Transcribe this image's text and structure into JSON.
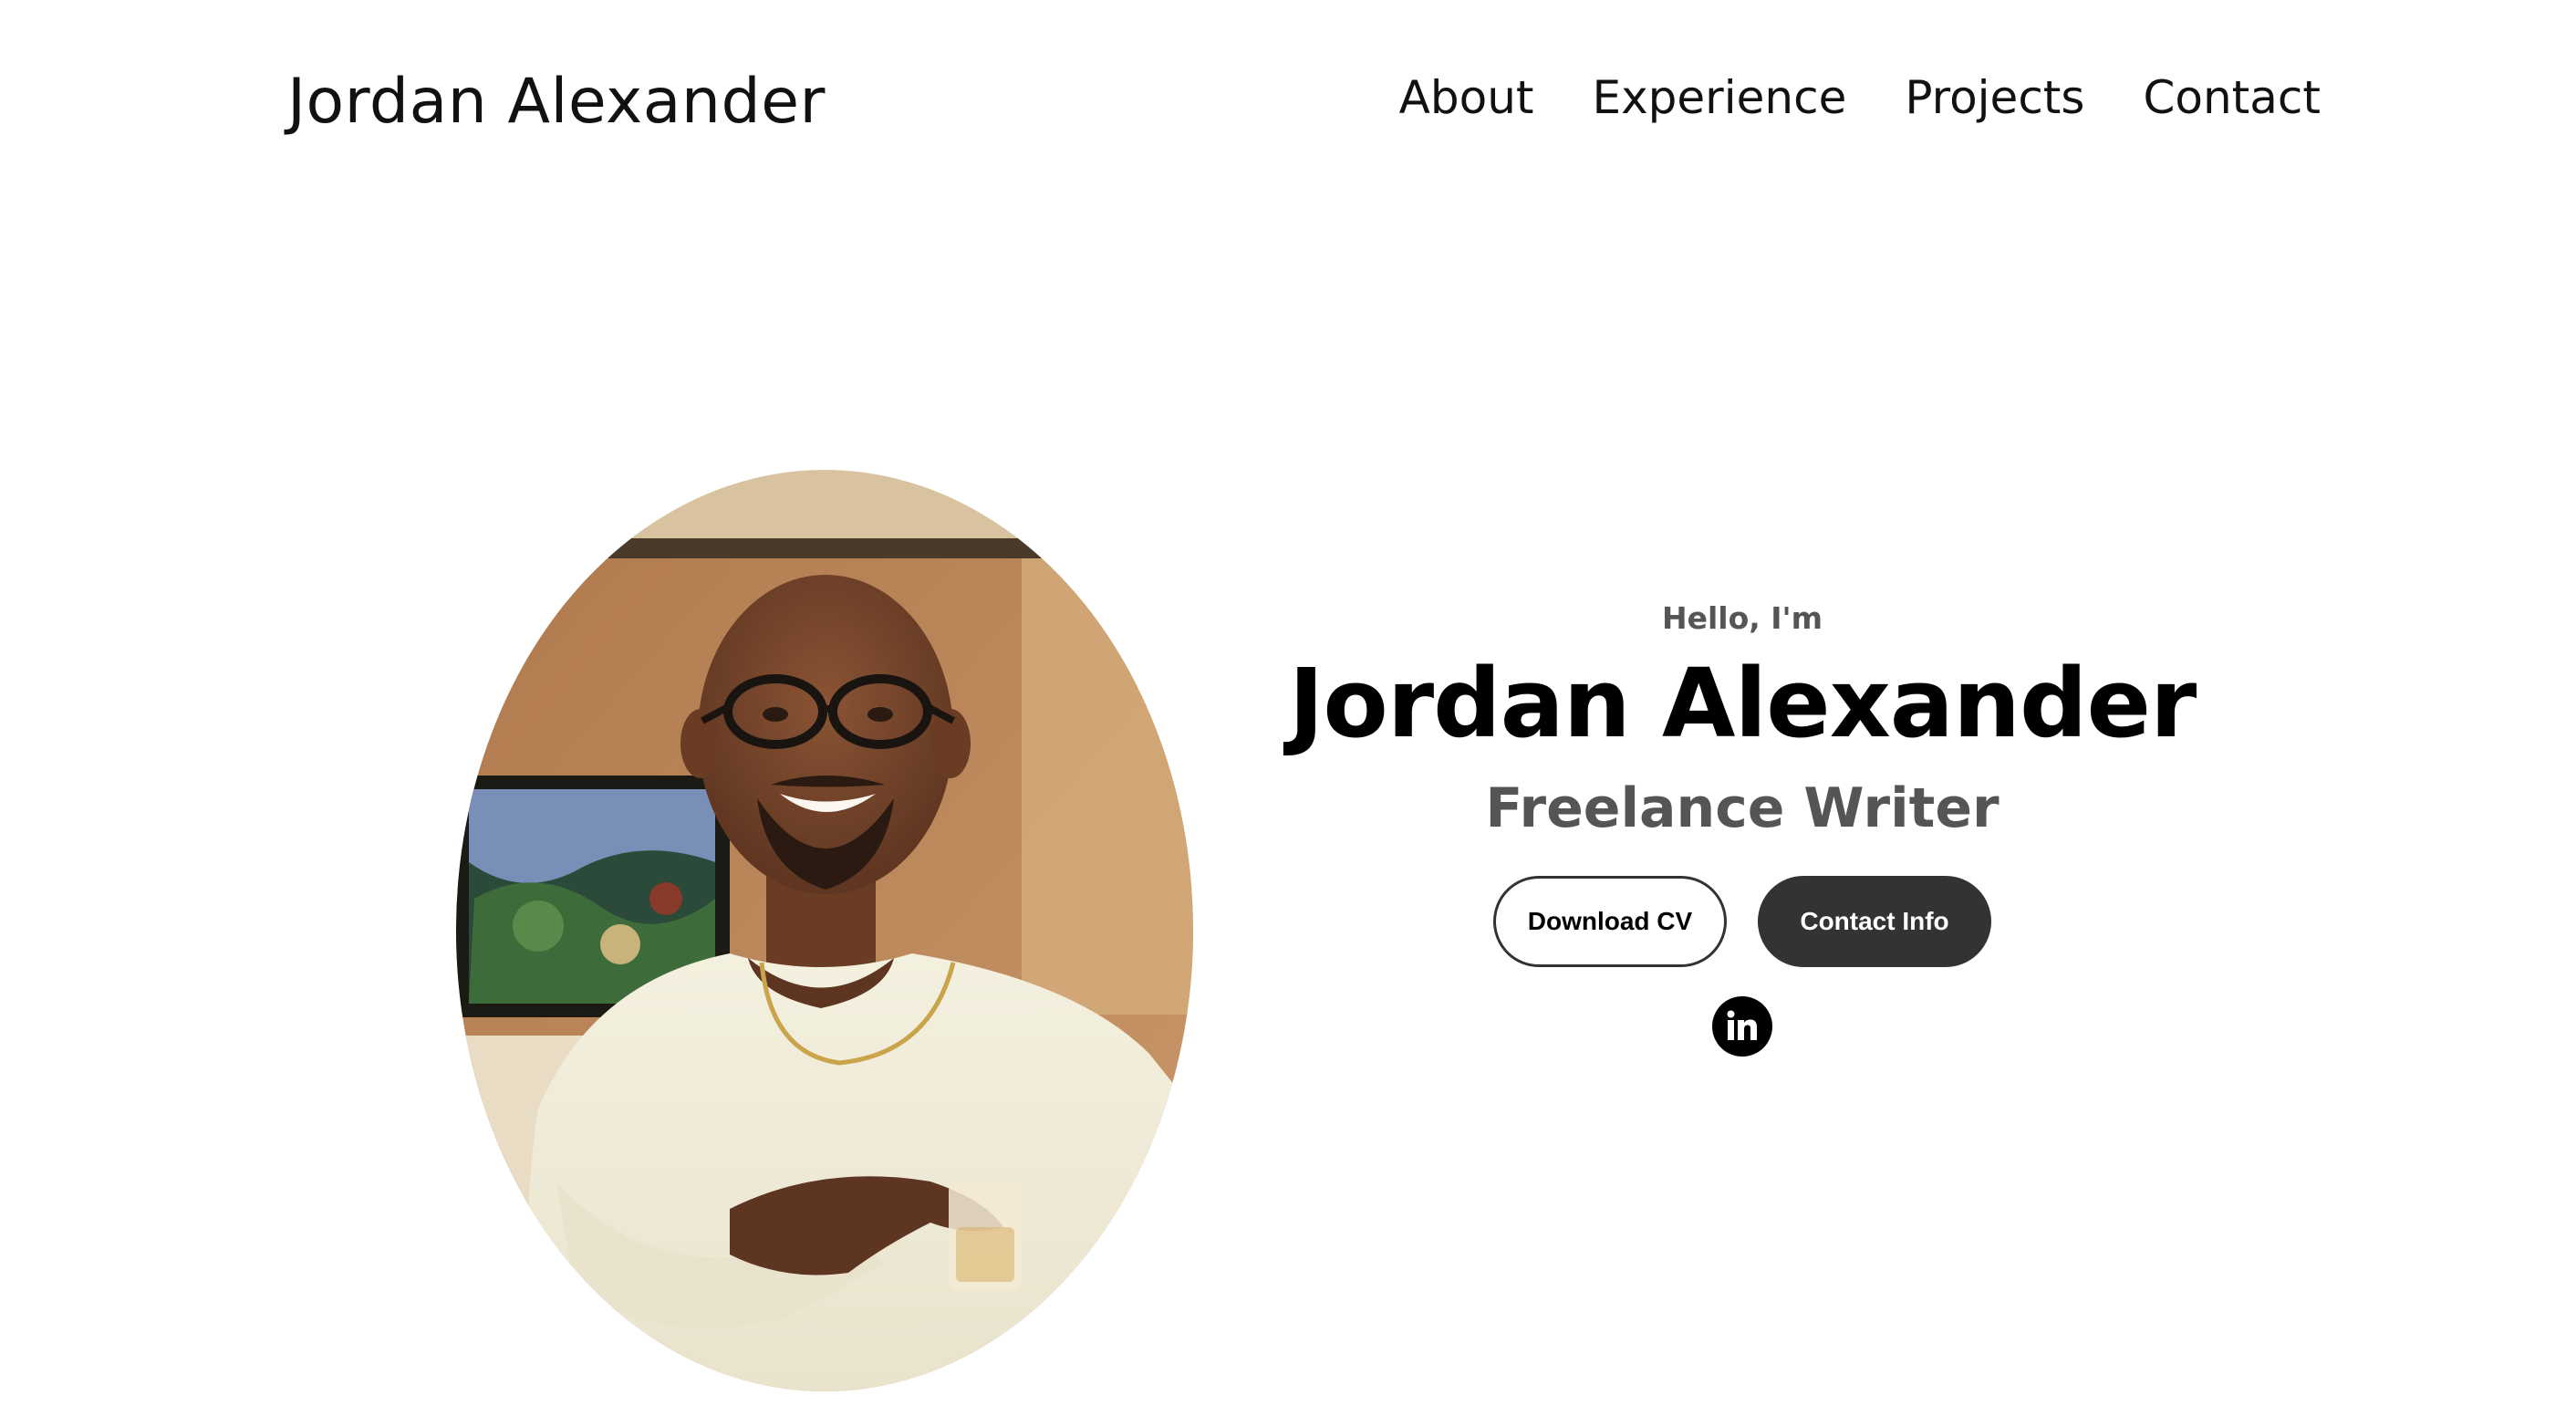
{
  "header": {
    "logo_text": "Jordan Alexander",
    "nav": [
      "About",
      "Experience",
      "Projects",
      "Contact"
    ]
  },
  "hero": {
    "greeting": "Hello, I'm",
    "name": "Jordan Alexander",
    "title": "Freelance Writer",
    "buttons": {
      "download_cv": "Download CV",
      "contact_info": "Contact Info"
    },
    "social": {
      "icon": "linkedin-icon"
    }
  },
  "colors": {
    "text": "#000000",
    "muted": "#555555",
    "button_dark": "#333333",
    "background": "#ffffff"
  }
}
